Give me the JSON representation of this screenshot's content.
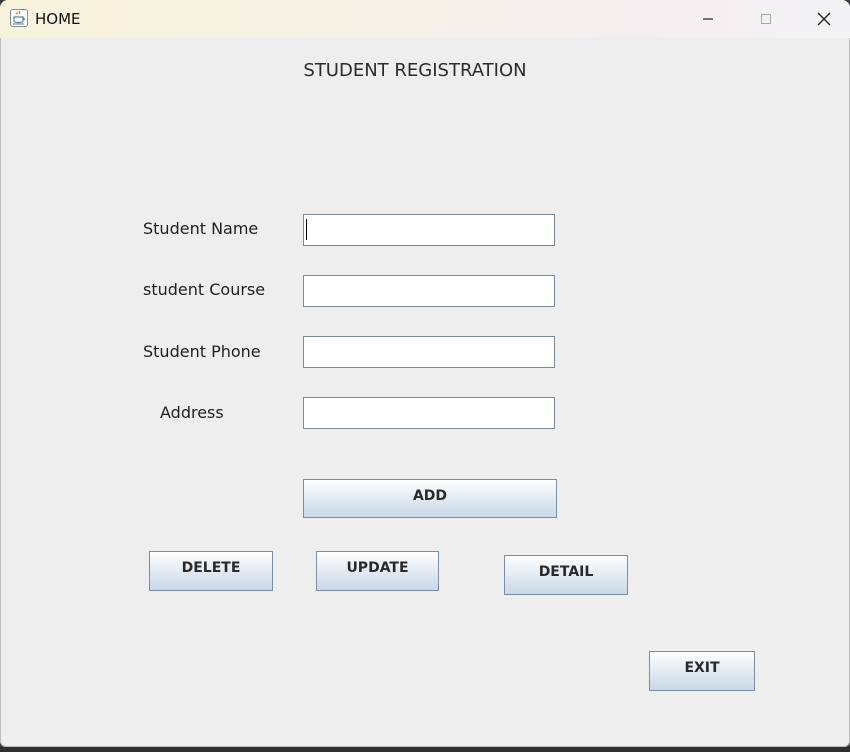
{
  "window": {
    "title": "HOME",
    "controls": {
      "minimize_icon": "minimize-icon",
      "maximize_icon": "maximize-icon",
      "close_icon": "close-icon"
    }
  },
  "form": {
    "heading": "STUDENT REGISTRATION",
    "fields": [
      {
        "label": "Student Name",
        "value": ""
      },
      {
        "label": "student Course",
        "value": ""
      },
      {
        "label": "Student Phone",
        "value": ""
      },
      {
        "label": "Address",
        "value": ""
      }
    ]
  },
  "buttons": {
    "add": "ADD",
    "delete": "DELETE",
    "update": "UPDATE",
    "detail": "DETAIL",
    "exit": "EXIT"
  },
  "colors": {
    "window_bg": "#eeeeee",
    "button_border": "#7a8fa6",
    "field_border": "#7a8a99"
  }
}
